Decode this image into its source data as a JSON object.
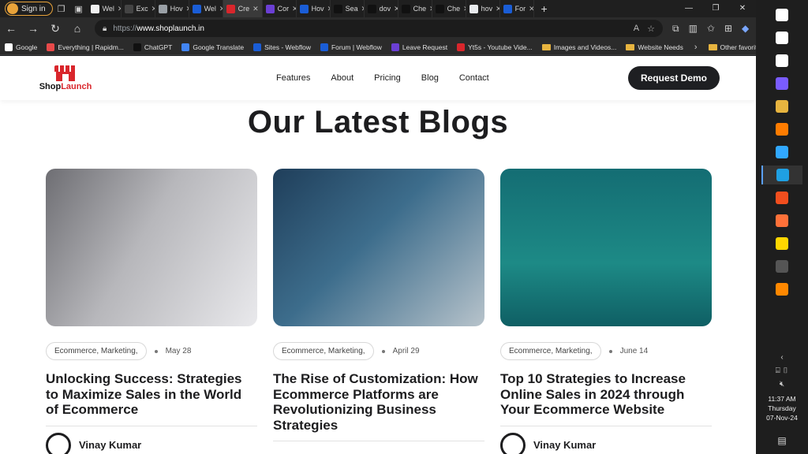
{
  "browser": {
    "signin_label": "Sign in",
    "tabs": [
      {
        "label": "Wel",
        "color": "#f1f1f1"
      },
      {
        "label": "Exc",
        "color": "#444444"
      },
      {
        "label": "Hov",
        "color": "#9aa0a6"
      },
      {
        "label": "Wel",
        "color": "#1a5dd6"
      },
      {
        "label": "Cre",
        "color": "#d9262c",
        "active": true
      },
      {
        "label": "Cor",
        "color": "#6b3fd4"
      },
      {
        "label": "Hov",
        "color": "#1a5dd6"
      },
      {
        "label": "Sea",
        "color": "#111111"
      },
      {
        "label": "dov",
        "color": "#111111"
      },
      {
        "label": "Che",
        "color": "#111111"
      },
      {
        "label": "Che",
        "color": "#111111"
      },
      {
        "label": "hov",
        "color": "#e8eaed"
      },
      {
        "label": "For",
        "color": "#1a5dd6"
      }
    ],
    "url_protocol": "https://",
    "url_host": "www.shoplaunch.in",
    "bookmarks": [
      {
        "label": "Google",
        "color": "#ffffff"
      },
      {
        "label": "Everything | Rapidm...",
        "color": "#e84a4a"
      },
      {
        "label": "ChatGPT",
        "color": "#111111"
      },
      {
        "label": "Google Translate",
        "color": "#4285f4"
      },
      {
        "label": "Sites - Webflow",
        "color": "#1a5dd6"
      },
      {
        "label": "Forum | Webflow",
        "color": "#1a5dd6"
      },
      {
        "label": "Leave Request",
        "color": "#6b3fd4"
      },
      {
        "label": "Yt5s - Youtube Vide...",
        "color": "#d9262c"
      },
      {
        "label": "Images and Videos...",
        "color": "#e7b43f",
        "folder": true
      },
      {
        "label": "Website Needs",
        "color": "#e7b43f",
        "folder": true
      }
    ],
    "other_favorites": "Other favorites"
  },
  "site": {
    "brand_prefix": "Shop",
    "brand_suffix": "Launch",
    "nav": [
      "Features",
      "About",
      "Pricing",
      "Blog",
      "Contact"
    ],
    "cta": "Request Demo",
    "section_title": "Our Latest Blogs",
    "cards": [
      {
        "tag": "Ecommerce, Marketing,",
        "date": "May 28",
        "title": "Unlocking Success: Strategies to Maximize Sales in the World of Ecommerce",
        "author": "Vinay Kumar"
      },
      {
        "tag": "Ecommerce, Marketing,",
        "date": "April 29",
        "title": "The Rise of Customization: How Ecommerce Platforms are Revolutionizing Business Strategies",
        "author": ""
      },
      {
        "tag": "Ecommerce, Marketing,",
        "date": "June 14",
        "title": "Top 10 Strategies to Increase Online Sales in 2024 through Your Ecommerce Website",
        "author": "Vinay Kumar"
      }
    ]
  },
  "taskbar": {
    "time": "11:37 AM",
    "day": "Thursday",
    "date": "07-Nov-24",
    "apps": [
      {
        "name": "windows",
        "color": "#ffffff"
      },
      {
        "name": "search",
        "color": "#ffffff"
      },
      {
        "name": "task-view",
        "color": "#ffffff"
      },
      {
        "name": "copilot",
        "color": "#7a5cff"
      },
      {
        "name": "file-explorer",
        "color": "#e7b43f"
      },
      {
        "name": "illustrator",
        "color": "#ff7c00"
      },
      {
        "name": "photoshop",
        "color": "#31a8ff"
      },
      {
        "name": "edge",
        "color": "#1fa0e3"
      },
      {
        "name": "figma",
        "color": "#f24e1e"
      },
      {
        "name": "firefox",
        "color": "#ff7139"
      },
      {
        "name": "sticky-notes",
        "color": "#ffd700"
      },
      {
        "name": "app-p",
        "color": "#555555"
      },
      {
        "name": "vlc",
        "color": "#ff8800"
      }
    ]
  }
}
